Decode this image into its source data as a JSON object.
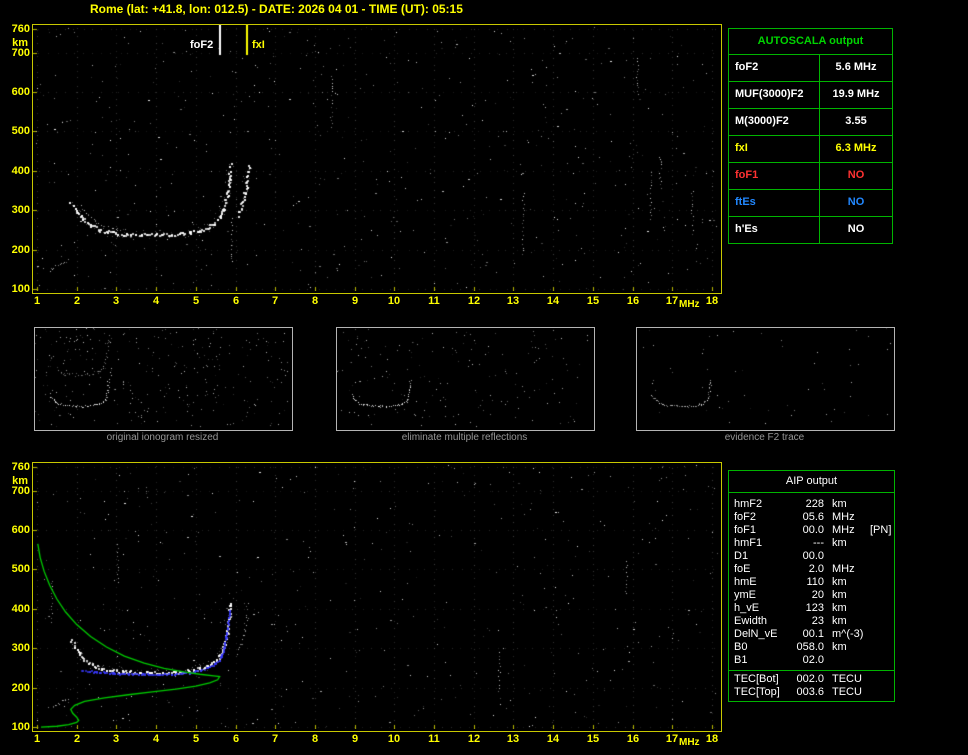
{
  "window": {
    "title": "Rome (lat: +41.8, lon: 012.5) - DATE: 2026 04 01 - TIME (UT): 05:15"
  },
  "colors": {
    "background": "#000000",
    "axis_yellow": "#ffff00",
    "frame_yellow": "#c8c800",
    "table_green": "#00b400",
    "profile_green": "#00cc00",
    "restored_blue": "#3838ff",
    "trace_white": "#ffffff",
    "caption_gray": "#969696",
    "no_red": "#ff3232",
    "es_blue": "#2288ff"
  },
  "autoscala": {
    "title": "AUTOSCALA output",
    "rows": [
      {
        "label": "foF2",
        "value": "5.6 MHz",
        "color": "#ffffff"
      },
      {
        "label": "MUF(3000)F2",
        "value": "19.9 MHz",
        "color": "#ffffff"
      },
      {
        "label": "M(3000)F2",
        "value": "3.55",
        "color": "#ffffff"
      },
      {
        "label": "fxI",
        "value": "6.3 MHz",
        "color": "#ffff00"
      },
      {
        "label": "foF1",
        "value": "NO",
        "color": "#ff3232"
      },
      {
        "label": "ftEs",
        "value": "NO",
        "color": "#2288ff"
      },
      {
        "label": "h'Es",
        "value": "NO",
        "color": "#ffffff"
      }
    ]
  },
  "thumbnails": [
    {
      "caption": "original ionogram resized"
    },
    {
      "caption": "eliminate multiple reflections"
    },
    {
      "caption": "evidence F2 trace"
    }
  ],
  "aip": {
    "title": "AIP output",
    "rows": [
      {
        "label": "hmF2",
        "value": "228",
        "unit": "km",
        "note": ""
      },
      {
        "label": "foF2",
        "value": "05.6",
        "unit": "MHz",
        "note": ""
      },
      {
        "label": "foF1",
        "value": "00.0",
        "unit": "MHz",
        "note": "[PN]"
      },
      {
        "label": "hmF1",
        "value": "---",
        "unit": "km",
        "note": ""
      },
      {
        "label": "D1",
        "value": "00.0",
        "unit": "",
        "note": ""
      },
      {
        "label": "foE",
        "value": "2.0",
        "unit": "MHz",
        "note": ""
      },
      {
        "label": "hmE",
        "value": "110",
        "unit": "km",
        "note": ""
      },
      {
        "label": "ymE",
        "value": "20",
        "unit": "km",
        "note": ""
      },
      {
        "label": "h_vE",
        "value": "123",
        "unit": "km",
        "note": ""
      },
      {
        "label": "Ewidth",
        "value": "23",
        "unit": "km",
        "note": ""
      },
      {
        "label": "DelN_vE",
        "value": "00.1",
        "unit": "m^(-3)",
        "note": ""
      },
      {
        "label": "B0",
        "value": "058.0",
        "unit": "km",
        "note": ""
      },
      {
        "label": "B1",
        "value": "02.0",
        "unit": "",
        "note": ""
      }
    ],
    "tec_rows": [
      {
        "label": "TEC[Bot]",
        "value": "002.0",
        "unit": "TECU",
        "note": ""
      },
      {
        "label": "TEC[Top]",
        "value": "003.6",
        "unit": "TECU",
        "note": ""
      }
    ]
  },
  "chart_data": [
    {
      "type": "scatter",
      "title": "ionogram with autoscaled characteristics",
      "xlabel": "MHz",
      "ylabel": "km",
      "xlim": [
        1,
        18
      ],
      "ylim": [
        100,
        760
      ],
      "x_ticks": [
        1,
        2,
        3,
        4,
        5,
        6,
        7,
        8,
        9,
        10,
        11,
        12,
        13,
        14,
        15,
        16,
        17,
        18
      ],
      "y_ticks": [
        760,
        700,
        600,
        500,
        400,
        300,
        200,
        100
      ],
      "grid": "dotted",
      "markers": [
        {
          "label": "foF2",
          "value_mhz": 5.6,
          "color": "#ffffff"
        },
        {
          "label": "fxI",
          "value_mhz": 6.3,
          "color": "#ffff00"
        }
      ],
      "series": [
        {
          "name": "F2-trace-ordinary",
          "render": "trace",
          "color": "#ffffff",
          "points": [
            [
              1.85,
              320
            ],
            [
              2.0,
              296
            ],
            [
              2.15,
              276
            ],
            [
              2.35,
              260
            ],
            [
              2.6,
              250
            ],
            [
              2.9,
              244
            ],
            [
              3.2,
              241
            ],
            [
              3.6,
              239
            ],
            [
              4.0,
              239
            ],
            [
              4.4,
              240
            ],
            [
              4.8,
              243
            ],
            [
              5.05,
              248
            ],
            [
              5.25,
              255
            ],
            [
              5.45,
              266
            ],
            [
              5.6,
              282
            ],
            [
              5.7,
              305
            ],
            [
              5.78,
              340
            ],
            [
              5.83,
              380
            ],
            [
              5.86,
              418
            ]
          ]
        },
        {
          "name": "F2-trace-extraordinary-arc",
          "render": "trace-faint",
          "color": "#ffffff",
          "points": [
            [
              2.1,
              312
            ],
            [
              2.25,
              292
            ],
            [
              2.45,
              274
            ],
            [
              2.7,
              261
            ],
            [
              2.95,
              253
            ],
            [
              3.2,
              248
            ]
          ]
        },
        {
          "name": "F2-trace-extraordinary-rise",
          "render": "trace",
          "color": "#ffffff",
          "points": [
            [
              6.05,
              288
            ],
            [
              6.15,
              314
            ],
            [
              6.22,
              344
            ],
            [
              6.27,
              378
            ],
            [
              6.3,
              412
            ]
          ]
        },
        {
          "name": "E-region-echo",
          "render": "trace-faint",
          "color": "#ffffff",
          "points": [
            [
              1.3,
              148
            ],
            [
              1.42,
              154
            ],
            [
              1.55,
              161
            ],
            [
              1.68,
              168
            ],
            [
              1.78,
              174
            ]
          ]
        }
      ]
    },
    {
      "type": "scatter",
      "title": "ionogram with restored trace and electron density profile",
      "xlabel": "MHz",
      "ylabel": "km",
      "xlim": [
        1,
        18
      ],
      "ylim": [
        100,
        760
      ],
      "x_ticks": [
        1,
        2,
        3,
        4,
        5,
        6,
        7,
        8,
        9,
        10,
        11,
        12,
        13,
        14,
        15,
        16,
        17,
        18
      ],
      "y_ticks": [
        760,
        700,
        600,
        500,
        400,
        300,
        200,
        100
      ],
      "grid": "dotted",
      "series": [
        {
          "name": "F2-trace-ordinary",
          "render": "trace",
          "color": "#ffffff",
          "points": [
            [
              1.85,
              320
            ],
            [
              2.0,
              296
            ],
            [
              2.15,
              276
            ],
            [
              2.35,
              260
            ],
            [
              2.6,
              250
            ],
            [
              2.9,
              244
            ],
            [
              3.2,
              241
            ],
            [
              3.6,
              239
            ],
            [
              4.0,
              239
            ],
            [
              4.4,
              240
            ],
            [
              4.8,
              243
            ],
            [
              5.05,
              248
            ],
            [
              5.25,
              255
            ],
            [
              5.45,
              266
            ],
            [
              5.6,
              282
            ],
            [
              5.7,
              305
            ],
            [
              5.78,
              340
            ],
            [
              5.83,
              380
            ],
            [
              5.86,
              418
            ]
          ]
        },
        {
          "name": "F2-trace-extraordinary-rise",
          "render": "trace-faint",
          "color": "#ffffff",
          "points": [
            [
              6.05,
              288
            ],
            [
              6.15,
              314
            ],
            [
              6.22,
              344
            ],
            [
              6.27,
              378
            ],
            [
              6.3,
              412
            ]
          ]
        },
        {
          "name": "E-region-echo",
          "render": "trace-faint",
          "color": "#ffffff",
          "points": [
            [
              1.3,
              148
            ],
            [
              1.42,
              154
            ],
            [
              1.55,
              161
            ],
            [
              1.68,
              168
            ],
            [
              1.78,
              174
            ]
          ]
        },
        {
          "name": "restored-trace",
          "render": "dots",
          "color": "#3838ff",
          "points": [
            [
              2.1,
              246
            ],
            [
              2.5,
              241
            ],
            [
              2.9,
              238
            ],
            [
              3.3,
              236
            ],
            [
              3.7,
              235
            ],
            [
              4.1,
              235
            ],
            [
              4.5,
              237
            ],
            [
              4.85,
              240
            ],
            [
              5.1,
              245
            ],
            [
              5.3,
              252
            ],
            [
              5.5,
              263
            ],
            [
              5.62,
              280
            ],
            [
              5.7,
              302
            ],
            [
              5.76,
              330
            ],
            [
              5.8,
              362
            ],
            [
              5.83,
              398
            ]
          ]
        },
        {
          "name": "electron-density-profile",
          "render": "line",
          "color": "#00cc00",
          "points": [
            [
              1.02,
              565
            ],
            [
              1.08,
              530
            ],
            [
              1.18,
              495
            ],
            [
              1.32,
              460
            ],
            [
              1.5,
              425
            ],
            [
              1.72,
              392
            ],
            [
              2.0,
              360
            ],
            [
              2.35,
              330
            ],
            [
              2.75,
              303
            ],
            [
              3.2,
              280
            ],
            [
              3.7,
              262
            ],
            [
              4.2,
              249
            ],
            [
              4.7,
              240
            ],
            [
              5.1,
              234
            ],
            [
              5.45,
              230
            ],
            [
              5.6,
              228
            ],
            [
              5.55,
              220
            ],
            [
              5.35,
              212
            ],
            [
              5.0,
              204
            ],
            [
              4.5,
              196
            ],
            [
              3.9,
              189
            ],
            [
              3.3,
              182
            ],
            [
              2.7,
              174
            ],
            [
              2.2,
              165
            ],
            [
              1.95,
              155
            ],
            [
              1.85,
              145
            ],
            [
              1.9,
              135
            ],
            [
              2.0,
              125
            ],
            [
              2.05,
              117
            ],
            [
              2.0,
              112
            ],
            [
              1.8,
              106
            ],
            [
              1.5,
              102
            ],
            [
              1.1,
              100
            ]
          ]
        }
      ]
    }
  ]
}
